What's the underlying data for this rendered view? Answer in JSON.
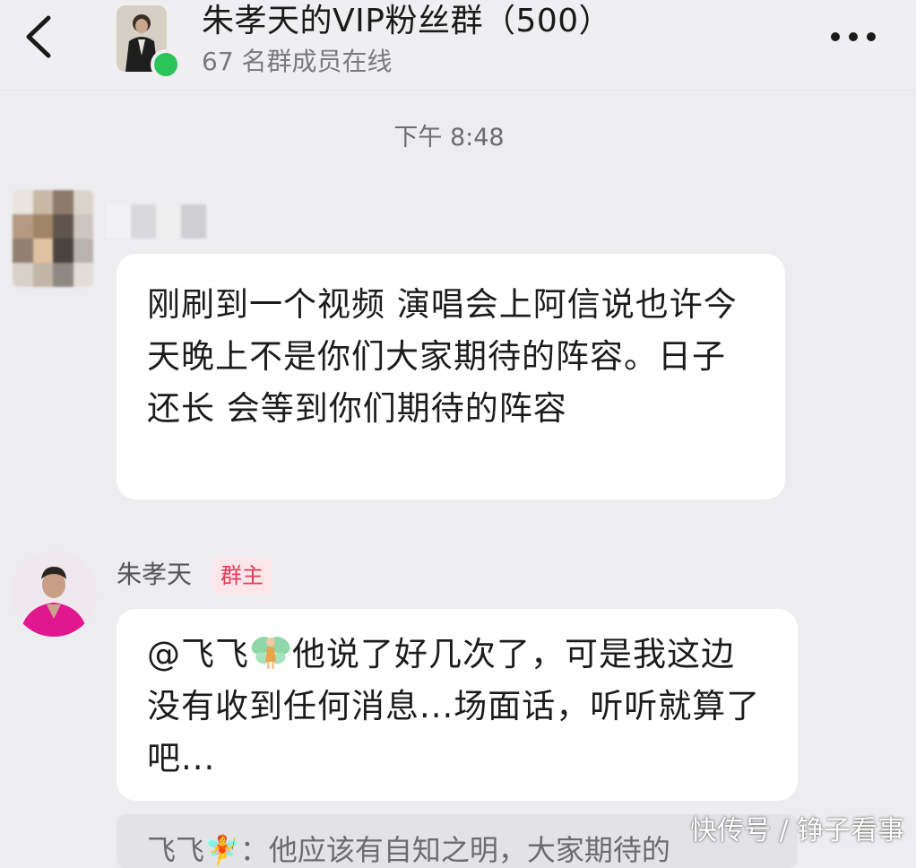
{
  "header": {
    "group_title": "朱孝天的VIP粉丝群（500）",
    "online_count": "67 名群成员在线",
    "back_icon": "chevron-left-icon",
    "more_icon": "more-horizontal-icon",
    "online_color": "#2bc45a"
  },
  "chat": {
    "timestamp": "下午 8:48",
    "messages": [
      {
        "sender_name": "",
        "avatar": "blurred-avatar",
        "text": "刚刷到一个视频 演唱会上阿信说也许今天晚上不是你们大家期待的阵容。日子还长 会等到你们期待的阵容"
      },
      {
        "sender_name": "朱孝天",
        "badge": "群主",
        "badge_color": "#e23a57",
        "mention": "@飞飞",
        "mention_icon": "fairy-icon",
        "text": "他说了好几次了，可是我这边没有收到任何消息...场面话，听听就算了吧..."
      }
    ],
    "quote_preview": "飞飞🧚：他应该有自知之明，大家期待的"
  },
  "watermark": "快传号 / 铮子看事"
}
